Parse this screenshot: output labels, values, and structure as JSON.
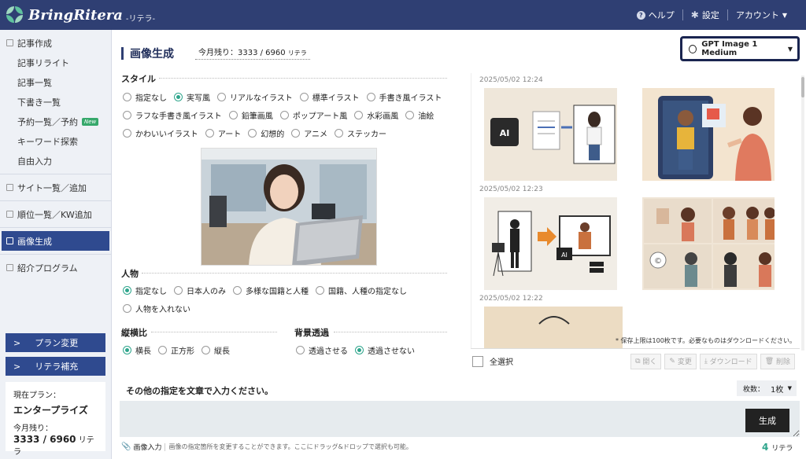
{
  "header": {
    "brand": "BringRitera",
    "brand_sub": "-リテラ-",
    "help": "ヘルプ",
    "settings": "設定",
    "account": "アカウント"
  },
  "sidebar": {
    "items": [
      {
        "label": "記事作成"
      },
      {
        "label": "記事リライト"
      },
      {
        "label": "記事一覧"
      },
      {
        "label": "下書き一覧"
      },
      {
        "label": "予約一覧／予約",
        "badge": "New"
      },
      {
        "label": "キーワード探索"
      },
      {
        "label": "自由入力"
      },
      {
        "label": "サイト一覧／追加"
      },
      {
        "label": "順位一覧／KW追加"
      },
      {
        "label": "画像生成"
      },
      {
        "label": "紹介プログラム"
      }
    ],
    "plan_change": "プラン変更",
    "ritera_topup": "リテラ補充",
    "plan": {
      "current_label": "現在プラン：",
      "name": "エンタープライズ",
      "remain_label": "今月残り：",
      "remain_value": "3333 / 6960",
      "remain_unit": "リテラ"
    }
  },
  "main": {
    "title": "画像生成",
    "remain_text": "今月残り：3333 / 6960",
    "remain_unit": "リテラ",
    "model": "GPT Image 1 Medium",
    "style": {
      "label": "スタイル",
      "options": [
        "指定なし",
        "実写風",
        "リアルなイラスト",
        "標準イラスト",
        "手書き風イラスト",
        "ラフな手書き風イラスト",
        "鉛筆画風",
        "ポップアート風",
        "水彩画風",
        "油絵",
        "かわいいイラスト",
        "アート",
        "幻想的",
        "アニメ",
        "ステッカー"
      ],
      "selected": "実写風"
    },
    "person": {
      "label": "人物",
      "options": [
        "指定なし",
        "日本人のみ",
        "多様な国籍と人種",
        "国籍、人種の指定なし",
        "人物を入れない"
      ],
      "selected": "指定なし"
    },
    "aspect": {
      "label": "縦横比",
      "options": [
        "横長",
        "正方形",
        "縦長"
      ],
      "selected": "横長"
    },
    "transparent": {
      "label": "背景透過",
      "options": [
        "透過させる",
        "透過させない"
      ],
      "selected": "透過させない"
    },
    "gallery": {
      "dates": [
        "2025/05/02 12:24",
        "2025/05/02 12:23",
        "2025/05/02 12:22"
      ],
      "save_note": "* 保存上限は100枚です。必要なものはダウンロードください。",
      "select_all": "全選択",
      "actions": [
        "開く",
        "変更",
        "ダウンロード",
        "削除"
      ]
    },
    "instruction": {
      "title": "その他の指定を文章で入力ください。",
      "count_label": "枚数：",
      "count_value": "1枚",
      "generate": "生成",
      "image_input": "画像入力",
      "hint": "画像の指定箇所を変更することができます。ここにドラッグ&ドロップで選択も可能。",
      "cost_value": "4",
      "cost_unit": "リテラ"
    }
  }
}
